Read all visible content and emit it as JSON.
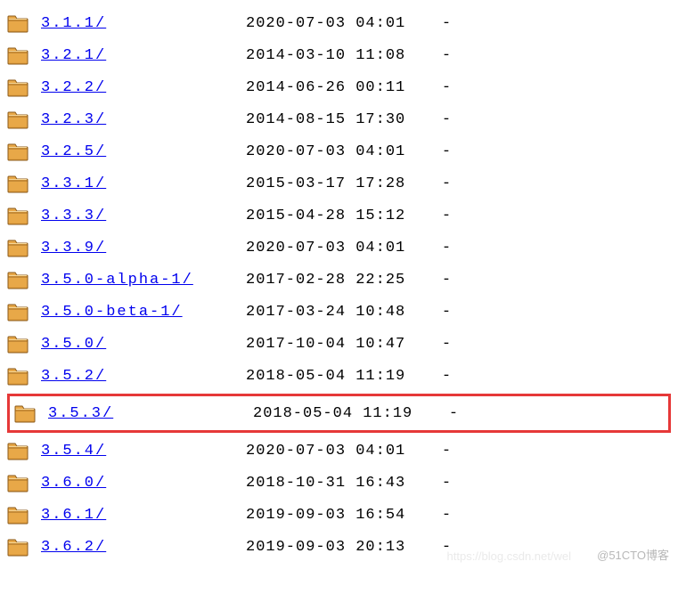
{
  "entries": [
    {
      "name": "3.1.1/",
      "date": "2020-07-03 04:01",
      "size": "-",
      "highlighted": false
    },
    {
      "name": "3.2.1/",
      "date": "2014-03-10 11:08",
      "size": "-",
      "highlighted": false
    },
    {
      "name": "3.2.2/",
      "date": "2014-06-26 00:11",
      "size": "-",
      "highlighted": false
    },
    {
      "name": "3.2.3/",
      "date": "2014-08-15 17:30",
      "size": "-",
      "highlighted": false
    },
    {
      "name": "3.2.5/",
      "date": "2020-07-03 04:01",
      "size": "-",
      "highlighted": false
    },
    {
      "name": "3.3.1/",
      "date": "2015-03-17 17:28",
      "size": "-",
      "highlighted": false
    },
    {
      "name": "3.3.3/",
      "date": "2015-04-28 15:12",
      "size": "-",
      "highlighted": false
    },
    {
      "name": "3.3.9/",
      "date": "2020-07-03 04:01",
      "size": "-",
      "highlighted": false
    },
    {
      "name": "3.5.0-alpha-1/",
      "date": "2017-02-28 22:25",
      "size": "-",
      "highlighted": false
    },
    {
      "name": "3.5.0-beta-1/",
      "date": "2017-03-24 10:48",
      "size": "-",
      "highlighted": false
    },
    {
      "name": "3.5.0/",
      "date": "2017-10-04 10:47",
      "size": "-",
      "highlighted": false
    },
    {
      "name": "3.5.2/",
      "date": "2018-05-04 11:19",
      "size": "-",
      "highlighted": false
    },
    {
      "name": "3.5.3/",
      "date": "2018-05-04 11:19",
      "size": "-",
      "highlighted": true
    },
    {
      "name": "3.5.4/",
      "date": "2020-07-03 04:01",
      "size": "-",
      "highlighted": false
    },
    {
      "name": "3.6.0/",
      "date": "2018-10-31 16:43",
      "size": "-",
      "highlighted": false
    },
    {
      "name": "3.6.1/",
      "date": "2019-09-03 16:54",
      "size": "-",
      "highlighted": false
    },
    {
      "name": "3.6.2/",
      "date": "2019-09-03 20:13",
      "size": "-",
      "highlighted": false
    }
  ],
  "watermark": "@51CTO博客",
  "watermark2": "https://blog.csdn.net/wel"
}
